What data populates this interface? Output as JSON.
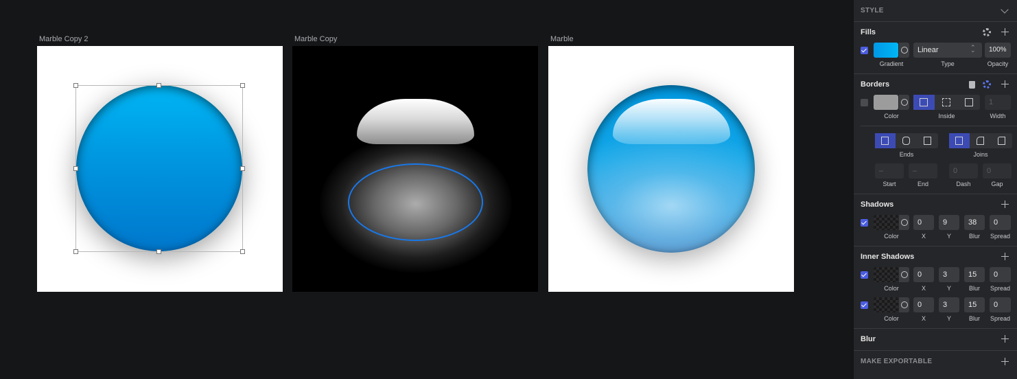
{
  "artboards": [
    {
      "label": "Marble Copy 2"
    },
    {
      "label": "Marble Copy"
    },
    {
      "label": "Marble"
    }
  ],
  "panel": {
    "style_title": "STYLE",
    "fills": {
      "title": "Fills",
      "enabled": true,
      "swatch_colors": [
        "#0098e6",
        "#00b6f5"
      ],
      "type_value": "Linear",
      "opacity_value": "100%",
      "labels": [
        "Gradient",
        "Type",
        "Opacity"
      ]
    },
    "borders": {
      "title": "Borders",
      "enabled": false,
      "swatch_color": "#9c9c9c",
      "width_value": "1",
      "labels": [
        "Color",
        "Inside",
        "Width"
      ],
      "ends_label": "Ends",
      "joins_label": "Joins",
      "start_value": "–",
      "end_value": "–",
      "dash_value": "0",
      "gap_value": "0",
      "dash_labels": [
        "Start",
        "End",
        "Dash",
        "Gap"
      ]
    },
    "shadows": {
      "title": "Shadows",
      "enabled": true,
      "x": "0",
      "y": "9",
      "blur": "38",
      "spread": "0",
      "labels": [
        "Color",
        "X",
        "Y",
        "Blur",
        "Spread"
      ]
    },
    "inner_shadows": {
      "title": "Inner Shadows",
      "rows": [
        {
          "enabled": true,
          "x": "0",
          "y": "3",
          "blur": "15",
          "spread": "0"
        },
        {
          "enabled": true,
          "x": "0",
          "y": "3",
          "blur": "15",
          "spread": "0"
        }
      ],
      "labels": [
        "Color",
        "X",
        "Y",
        "Blur",
        "Spread"
      ]
    },
    "blur": {
      "title": "Blur"
    },
    "exportable": {
      "title": "MAKE EXPORTABLE"
    }
  }
}
